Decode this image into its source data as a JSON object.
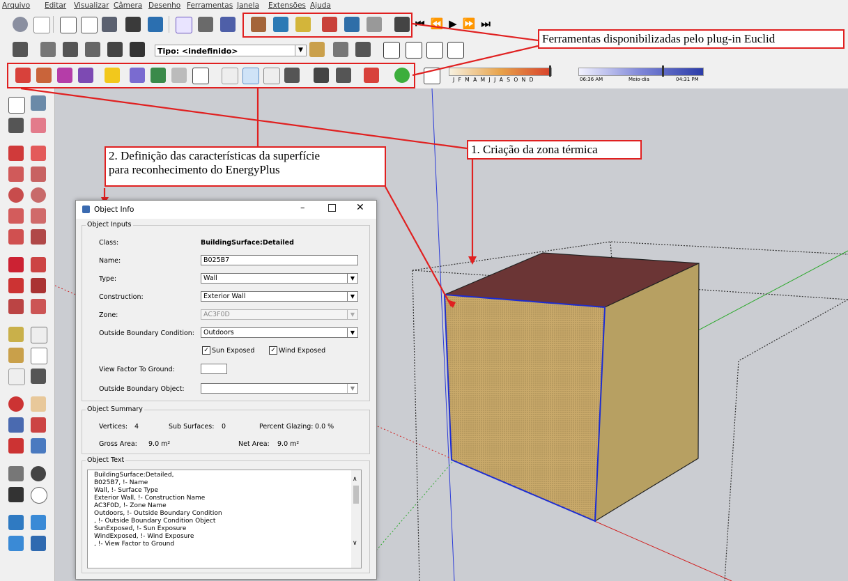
{
  "menu": [
    "Arquivo",
    "Editar",
    "Visualizar",
    "Câmera",
    "Desenho",
    "Ferramentas",
    "Janela",
    "Extensões",
    "Ajuda"
  ],
  "toolbar": {
    "tipo_label": "Tipo: <indefinido>",
    "shadow_months": "J F M A M J J A S O N D",
    "time_start": "06:36 AM",
    "time_mid": "Meio-dia",
    "time_end": "04:31 PM"
  },
  "annotations": {
    "euclid": "Ferramentas disponibilizadas pelo plug-in Euclid",
    "zone": "1. Criação da zona térmica",
    "surface_line1": "2. Definição das características da superfície",
    "surface_line2": "para reconhecimento do EnergyPlus"
  },
  "dialog": {
    "title": "Object Info",
    "inputs_group": "Object Inputs",
    "class_label": "Class:",
    "class_value": "BuildingSurface:Detailed",
    "name_label": "Name:",
    "name_value": "B025B7",
    "type_label": "Type:",
    "type_value": "Wall",
    "construction_label": "Construction:",
    "construction_value": "Exterior Wall",
    "zone_label": "Zone:",
    "zone_value": "AC3F0D",
    "obc_label": "Outside Boundary Condition:",
    "obc_value": "Outdoors",
    "sun_label": "Sun Exposed",
    "wind_label": "Wind Exposed",
    "sun_checked": true,
    "wind_checked": true,
    "vf_label": "View Factor To Ground:",
    "vf_value": "",
    "obo_label": "Outside Boundary Object:",
    "obo_value": "",
    "summary_group": "Object Summary",
    "vertices_label": "Vertices:",
    "vertices_value": "4",
    "subsurfaces_label": "Sub Surfaces:",
    "subsurfaces_value": "0",
    "glazing_label": "Percent Glazing:",
    "glazing_value": "0.0 %",
    "gross_label": "Gross Area:",
    "gross_value": "9.0 m²",
    "net_label": "Net Area:",
    "net_value": "9.0 m²",
    "text_group": "Object Text",
    "text_lines": [
      "BuildingSurface:Detailed,",
      "  B025B7,  !- Name",
      "  Wall,  !- Surface Type",
      "  Exterior Wall,  !- Construction Name",
      "  AC3F0D,  !- Zone Name",
      "  Outdoors,  !- Outside Boundary Condition",
      "  ,  !- Outside Boundary Condition Object",
      "  SunExposed,  !- Sun Exposure",
      "  WindExposed,  !- Wind Exposure",
      "  ,  !- View Factor to Ground"
    ]
  },
  "icons": {
    "dialog_app": "sketchup-logo-icon",
    "minimize": "minimize-icon",
    "maximize": "maximize-icon",
    "close": "close-icon"
  },
  "colors": {
    "annotation_red": "#e02020",
    "roof": "#6b3535",
    "wall_front": "#c9a96a",
    "wall_side": "#b7a062",
    "edge_blue": "#1a2bd6"
  }
}
